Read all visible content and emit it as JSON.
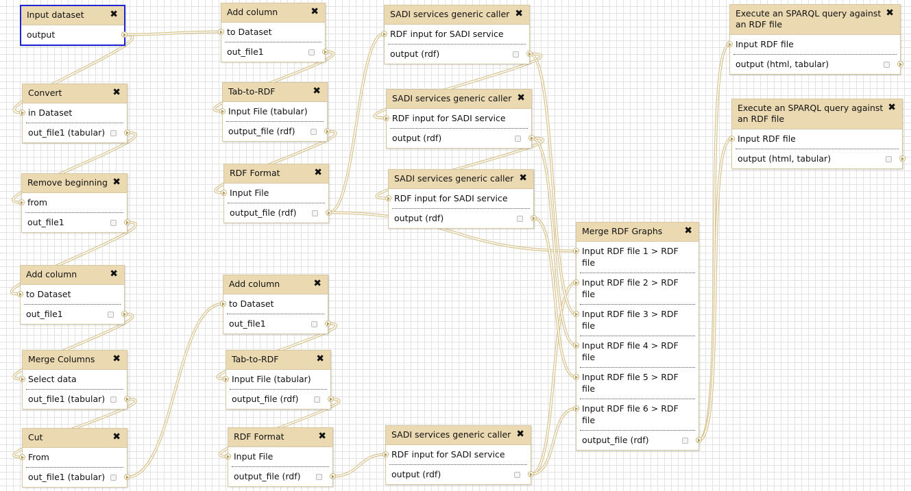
{
  "colors": {
    "node_header": "#ebd9b2",
    "node_border": "#d5c7a1",
    "selected_border": "#1c24d4",
    "wire": "#d8c38f"
  },
  "icons": {
    "close": "close-icon",
    "terminal": "connector-arrow-icon",
    "checkbox": "checkbox-icon"
  },
  "nodes": [
    {
      "title": "Input dataset",
      "inputs": [],
      "outputs": [
        "output"
      ],
      "selected": true
    },
    {
      "title": "Convert",
      "inputs": [
        "in Dataset"
      ],
      "outputs": [
        "out_file1 (tabular)"
      ]
    },
    {
      "title": "Remove beginning",
      "inputs": [
        "from"
      ],
      "outputs": [
        "out_file1"
      ]
    },
    {
      "title": "Add column",
      "inputs": [
        "to Dataset"
      ],
      "outputs": [
        "out_file1"
      ]
    },
    {
      "title": "Merge Columns",
      "inputs": [
        "Select data"
      ],
      "outputs": [
        "out_file1 (tabular)"
      ]
    },
    {
      "title": "Cut",
      "inputs": [
        "From"
      ],
      "outputs": [
        "out_file1 (tabular)"
      ]
    },
    {
      "title": "Add column",
      "inputs": [
        "to Dataset"
      ],
      "outputs": [
        "out_file1"
      ]
    },
    {
      "title": "Tab-to-RDF",
      "inputs": [
        "Input File (tabular)"
      ],
      "outputs": [
        "output_file (rdf)"
      ]
    },
    {
      "title": "RDF Format",
      "inputs": [
        "Input File"
      ],
      "outputs": [
        "output_file (rdf)"
      ]
    },
    {
      "title": "Add column",
      "inputs": [
        "to Dataset"
      ],
      "outputs": [
        "out_file1"
      ]
    },
    {
      "title": "Tab-to-RDF",
      "inputs": [
        "Input File (tabular)"
      ],
      "outputs": [
        "output_file (rdf)"
      ]
    },
    {
      "title": "RDF Format",
      "inputs": [
        "Input File"
      ],
      "outputs": [
        "output_file (rdf)"
      ]
    },
    {
      "title": "SADI services generic caller",
      "inputs": [
        "RDF input for SADI service"
      ],
      "outputs": [
        "output (rdf)"
      ]
    },
    {
      "title": "SADI services generic caller",
      "inputs": [
        "RDF input for SADI service"
      ],
      "outputs": [
        "output (rdf)"
      ]
    },
    {
      "title": "SADI services generic caller",
      "inputs": [
        "RDF input for SADI service"
      ],
      "outputs": [
        "output (rdf)"
      ]
    },
    {
      "title": "SADI services generic caller",
      "inputs": [
        "RDF input for SADI service"
      ],
      "outputs": [
        "output (rdf)"
      ]
    },
    {
      "title": "Merge RDF Graphs",
      "inputs": [
        "Input RDF file 1 > RDF file",
        "Input RDF file 2 > RDF file",
        "Input RDF file 3 > RDF file",
        "Input RDF file 4 > RDF file",
        "Input RDF file 5 > RDF file",
        "Input RDF file 6 > RDF file"
      ],
      "outputs": [
        "output_file (rdf)"
      ]
    },
    {
      "title": "Execute an SPARQL query against an RDF file",
      "inputs": [
        "Input RDF file"
      ],
      "outputs": [
        "output (html, tabular)"
      ]
    },
    {
      "title": "Execute an SPARQL query against an RDF file",
      "inputs": [
        "Input RDF file"
      ],
      "outputs": [
        "output (html, tabular)"
      ]
    }
  ],
  "connections": [
    [
      0,
      0,
      1,
      0
    ],
    [
      1,
      0,
      2,
      0
    ],
    [
      2,
      0,
      3,
      0
    ],
    [
      3,
      0,
      4,
      0
    ],
    [
      4,
      0,
      5,
      0
    ],
    [
      0,
      0,
      6,
      0
    ],
    [
      6,
      0,
      7,
      0
    ],
    [
      7,
      0,
      8,
      0
    ],
    [
      5,
      0,
      9,
      0
    ],
    [
      9,
      0,
      10,
      0
    ],
    [
      10,
      0,
      11,
      0
    ],
    [
      8,
      0,
      12,
      0
    ],
    [
      12,
      0,
      13,
      0
    ],
    [
      13,
      0,
      14,
      0
    ],
    [
      11,
      0,
      15,
      0
    ],
    [
      8,
      0,
      16,
      0
    ],
    [
      15,
      0,
      16,
      1
    ],
    [
      12,
      0,
      16,
      2
    ],
    [
      13,
      0,
      16,
      3
    ],
    [
      14,
      0,
      16,
      4
    ],
    [
      15,
      0,
      16,
      5
    ],
    [
      16,
      0,
      17,
      0
    ],
    [
      16,
      0,
      18,
      0
    ]
  ]
}
